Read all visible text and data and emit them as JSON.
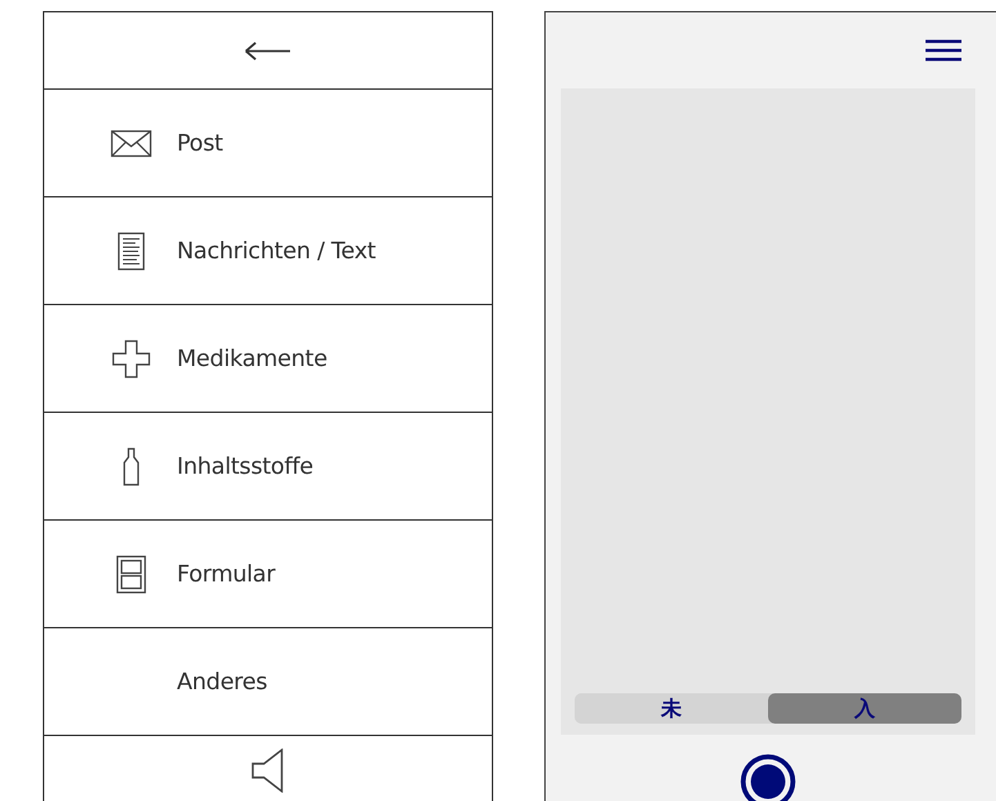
{
  "menu": {
    "items": [
      {
        "kind": "mail",
        "label": "Post"
      },
      {
        "kind": "text",
        "label": "Nachrichten / Text"
      },
      {
        "kind": "medication",
        "label": "Medikamente"
      },
      {
        "kind": "ingredients",
        "label": "Inhaltsstoffe"
      },
      {
        "kind": "form",
        "label": "Formular"
      },
      {
        "kind": "other",
        "label": "Anderes"
      }
    ]
  },
  "camera": {
    "segments": [
      {
        "label": "未",
        "selected": false
      },
      {
        "label": "入",
        "selected": true
      }
    ]
  }
}
